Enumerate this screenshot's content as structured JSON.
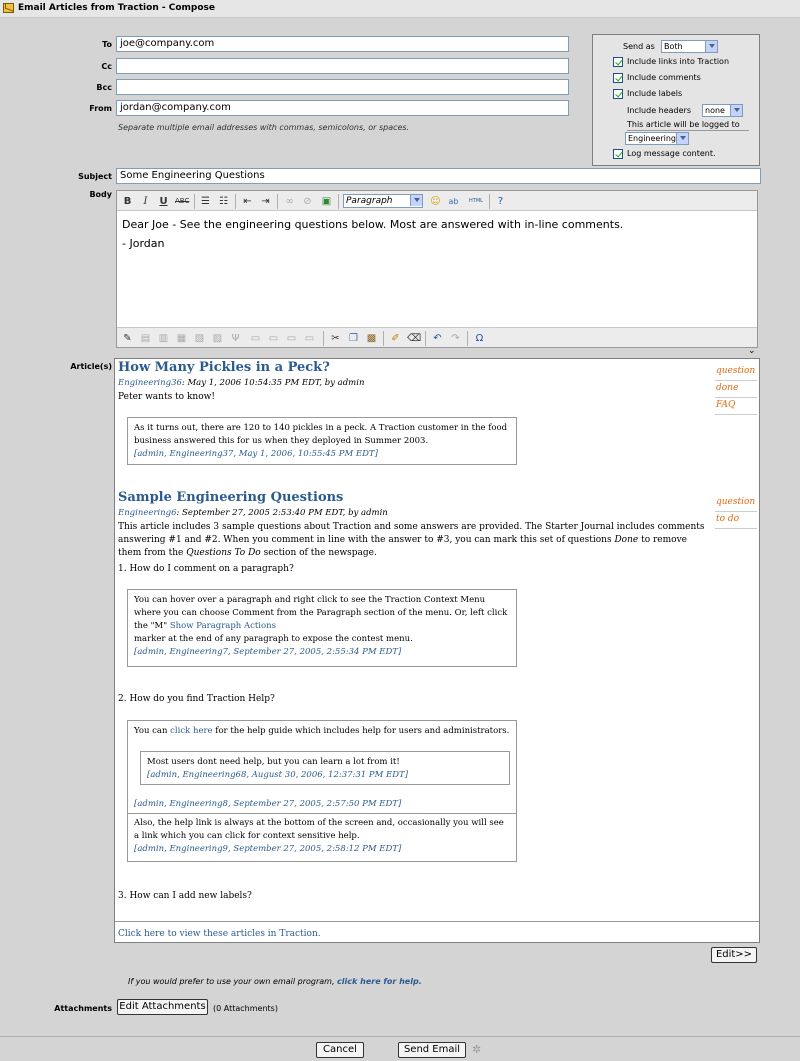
{
  "window": {
    "title": "Email Articles from Traction - Compose"
  },
  "fields": {
    "to_label": "To",
    "to_value": "joe@company.com",
    "cc_label": "Cc",
    "cc_value": "",
    "bcc_label": "Bcc",
    "bcc_value": "",
    "from_label": "From",
    "from_value": "jordan@company.com",
    "separator_hint": "Separate multiple email addresses with commas, semicolons, or spaces.",
    "subject_label": "Subject",
    "subject_value": "Some Engineering Questions",
    "body_label": "Body",
    "articles_label": "Article(s)",
    "attachments_label": "Attachments"
  },
  "options": {
    "send_as_label": "Send as",
    "send_as_value": "Both",
    "include_links": "Include links into Traction",
    "include_comments": "Include comments",
    "include_labels": "Include labels",
    "include_headers_label": "Include headers",
    "include_headers_value": "none",
    "logged_to_label": "This article will be logged to",
    "logged_to_value": "Engineering",
    "log_content": "Log message content."
  },
  "editor": {
    "format_value": "Paragraph",
    "html_label": "HTML",
    "line1": "Dear Joe - See the engineering questions below. Most are answered with in-line comments.",
    "line2": "- Jordan"
  },
  "articles": {
    "a1": {
      "title": "How Many Pickles in a Peck?",
      "meta_link": "Engineering36",
      "meta_rest": ": May 1, 2006 10:54:35 PM EDT, by admin",
      "body": "Peter wants to know!",
      "comment_text": "As it turns out, there are 120 to 140 pickles in a peck. A Traction customer in the food business answered this for us when they deployed in Summer 2003.",
      "comment_meta": "[admin, Engineering37, May 1, 2006, 10:55:45 PM EDT]",
      "tags": [
        "question",
        "done",
        "FAQ"
      ]
    },
    "a2": {
      "title": "Sample Engineering Questions",
      "meta_link": "Engineering6",
      "meta_rest": ": September 27, 2005 2:53:40 PM EDT, by admin",
      "body_start": "This article includes 3 sample questions about Traction and some answers are provided. The Starter Journal includes comments answering #1 and #2. When you comment in line with the answer to #3, you can mark this set of questions ",
      "body_done": "Done",
      "body_mid": " to remove them from the ",
      "body_todo": "Questions To Do",
      "body_end": " section of the newspage.",
      "q1": "1. How do I comment on a paragraph?",
      "c1_text": "You can hover over a paragraph and right click to see the Traction Context Menu where you can choose Comment from the Paragraph section of the menu. Or, left click the \"M\" ",
      "c1_link": "Show Paragraph Actions",
      "c1_text2": "marker at the end of any paragraph to expose the contest menu.",
      "c1_meta": "[admin, Engineering7, September 27, 2005, 2:55:34 PM EDT]",
      "q2": "2. How do you find Traction Help?",
      "c2_pre": "You can ",
      "c2_link": "click here",
      "c2_post": " for the help guide which includes help for users and administrators.",
      "c2n_text": "Most users dont need help, but you can learn a lot from it!",
      "c2n_meta": "[admin, Engineering68, August 30, 2006, 12:37:31 PM EDT]",
      "c2_meta": "[admin, Engineering8, September 27, 2005, 2:57:50 PM EDT]",
      "c3_text": "Also, the help link is always at the bottom of the screen and, occasionally you will see a link which you can click for context sensitive help.",
      "c3_meta": "[admin, Engineering9, September 27, 2005, 2:58:12 PM EDT]",
      "q3": "3. How can I add new labels?",
      "tags": [
        "question",
        "to do"
      ]
    },
    "view_link": "Click here to view these articles in Traction."
  },
  "footer": {
    "edit_btn": "Edit>>",
    "own_program_pre": "If you would prefer to use your own email program, ",
    "own_program_link": "click here for help.",
    "edit_attachments": "Edit Attachments",
    "attachments_count": "(0 Attachments)",
    "cancel": "Cancel",
    "send": "Send Email"
  }
}
